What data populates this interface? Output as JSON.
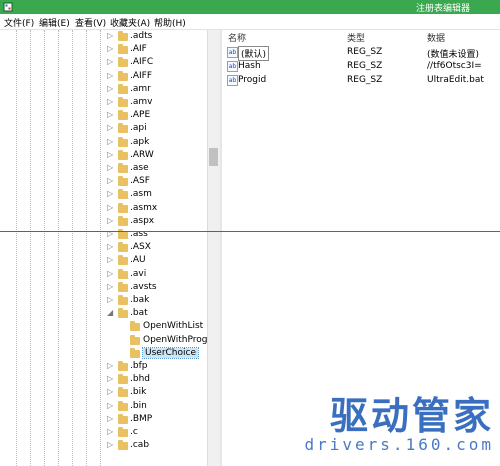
{
  "window": {
    "title": "注册表编辑器"
  },
  "menu": [
    "文件(F)",
    "编辑(E)",
    "查看(V)",
    "收藏夹(A)",
    "帮助(H)"
  ],
  "tree": {
    "items": [
      {
        "label": ".adts"
      },
      {
        "label": ".AIF"
      },
      {
        "label": ".AIFC"
      },
      {
        "label": ".AIFF"
      },
      {
        "label": ".amr"
      },
      {
        "label": ".amv"
      },
      {
        "label": ".APE"
      },
      {
        "label": ".api"
      },
      {
        "label": ".apk"
      },
      {
        "label": ".ARW"
      },
      {
        "label": ".ase"
      },
      {
        "label": ".ASF"
      },
      {
        "label": ".asm"
      },
      {
        "label": ".asmx"
      },
      {
        "label": ".aspx"
      },
      {
        "label": ".ass"
      },
      {
        "label": ".ASX"
      },
      {
        "label": ".AU"
      },
      {
        "label": ".avi"
      },
      {
        "label": ".avsts"
      },
      {
        "label": ".bak"
      },
      {
        "label": ".bat",
        "expanded": true
      },
      {
        "label": "OpenWithList",
        "child": true
      },
      {
        "label": "OpenWithProgid",
        "child": true
      },
      {
        "label": "UserChoice",
        "child": true,
        "selected": true
      },
      {
        "label": ".bfp"
      },
      {
        "label": ".bhd"
      },
      {
        "label": ".bik"
      },
      {
        "label": ".bin"
      },
      {
        "label": ".BMP"
      },
      {
        "label": ".c"
      },
      {
        "label": ".cab"
      }
    ]
  },
  "values": {
    "headers": {
      "name": "名称",
      "type": "类型",
      "data": "数据"
    },
    "rows": [
      {
        "name": "(默认)",
        "type": "REG_SZ",
        "data": "(数值未设置)"
      },
      {
        "name": "Hash",
        "type": "REG_SZ",
        "data": "//tf6Otsc3I="
      },
      {
        "name": "Progid",
        "type": "REG_SZ",
        "data": "UltraEdit.bat"
      }
    ]
  },
  "watermark": {
    "main": "驱动管家",
    "sub": "drivers.160.com"
  },
  "colors": {
    "titlebar": "#3aa84f",
    "selection": "#cde6f7",
    "folder": "#e8c162",
    "watermark": "#3a6fbf"
  }
}
